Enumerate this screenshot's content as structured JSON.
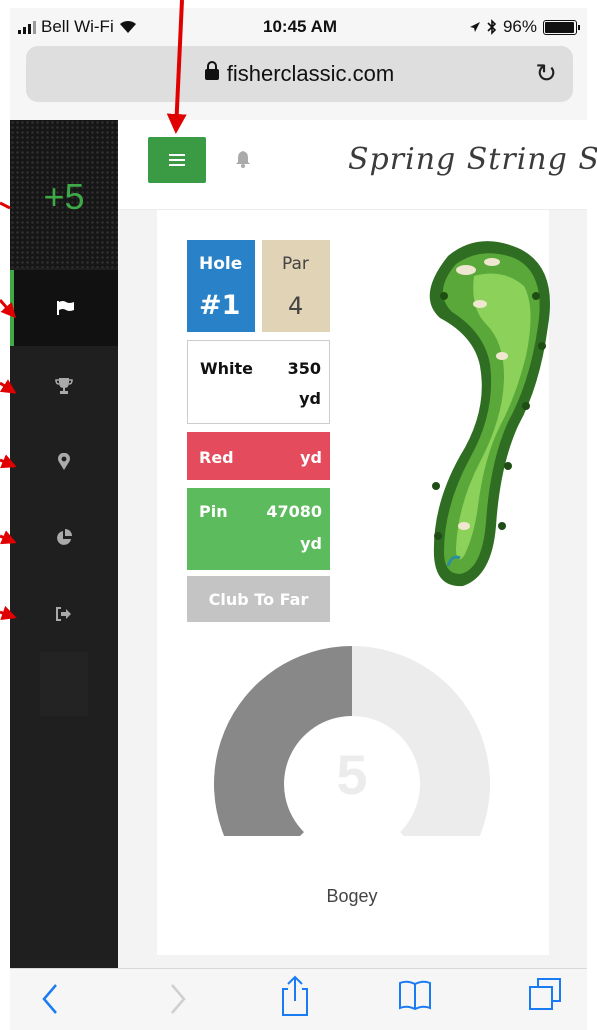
{
  "status_bar": {
    "carrier": "Bell Wi-Fi",
    "time": "10:45 AM",
    "battery": "96%",
    "battery_level": 0.96
  },
  "browser": {
    "url": "fisherclassic.com"
  },
  "sidebar": {
    "score": "+5",
    "items": [
      {
        "icon": "flag-icon",
        "active": true
      },
      {
        "icon": "trophy-icon",
        "active": false
      },
      {
        "icon": "map-pin-icon",
        "active": false
      },
      {
        "icon": "pie-chart-icon",
        "active": false
      },
      {
        "icon": "sign-out-icon",
        "active": false
      }
    ]
  },
  "header": {
    "brand": "Spring String Sc"
  },
  "hole_info": {
    "hole_label": "Hole",
    "hole_value": "#1",
    "par_label": "Par",
    "par_value": "4",
    "white_label": "White",
    "white_value": "350",
    "white_unit": "yd",
    "red_label": "Red",
    "red_unit": "yd",
    "pin_label": "Pin",
    "pin_value": "47080",
    "pin_unit": "yd",
    "club_label": "Club To Far"
  },
  "score_gauge": {
    "value": "5",
    "label": "Bogey",
    "fill_fraction": 0.5
  },
  "colors": {
    "accent_green": "#3b9b45",
    "hole_blue": "#2981c8",
    "par_tan": "#e0d3b6",
    "red": "#e44c5d",
    "pin_green": "#5cbb5c",
    "annotation_red": "#e00000"
  }
}
